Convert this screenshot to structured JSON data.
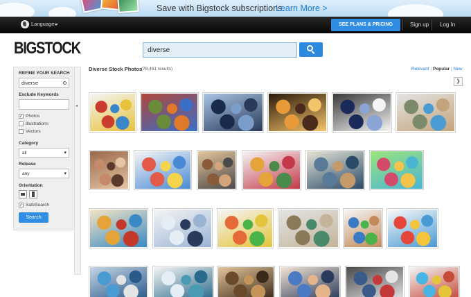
{
  "banner": {
    "text": "Save with Bigstock subscriptions.",
    "link": "Learn More >"
  },
  "topbar": {
    "language": "Language",
    "plans": "SEE PLANS & PRICING",
    "signup": "Sign up",
    "login": "Log In"
  },
  "header": {
    "logo": "BIGSTOCK",
    "search_value": "diverse"
  },
  "sidebar": {
    "refine_title": "REFINE YOUR SEARCH",
    "refine_value": "diverse",
    "exclude_title": "Exclude Keywords",
    "exclude_value": "",
    "types": [
      {
        "label": "Photos",
        "checked": true
      },
      {
        "label": "Illustrations",
        "checked": false
      },
      {
        "label": "Vectors",
        "checked": false
      }
    ],
    "category_title": "Category",
    "category_value": "all",
    "release_title": "Release",
    "release_value": "any",
    "orientation_title": "Orientation",
    "safesearch_label": "SafeSearch",
    "search_button": "Search"
  },
  "results": {
    "title": "Diverse Stock Photos",
    "count": "(78,461 results)",
    "sort_relevant": "Relevant",
    "sort_popular": "Popular",
    "sort_new": "New",
    "sep": "|"
  },
  "thumbnails": [
    {
      "subject": "crowd-group-photo",
      "colors": [
        "#c93c2e",
        "#3a86c9",
        "#e8c23a",
        "#f4f4f4"
      ]
    },
    {
      "subject": "social-media-icons",
      "colors": [
        "#6a8c3a",
        "#e07a2a",
        "#3a6ec9",
        "#b0463a"
      ]
    },
    {
      "subject": "silhouette-jumping",
      "colors": [
        "#1a2a4a",
        "#7a9ec9",
        "#2a3a5a",
        "#a8c4e4"
      ]
    },
    {
      "subject": "sunset-celebration",
      "colors": [
        "#e89a3a",
        "#4a2a1a",
        "#f4c46a",
        "#2a1a0a"
      ]
    },
    {
      "subject": "graduates",
      "colors": [
        "#1a2a5a",
        "#8aa4d4",
        "#f4f4f4",
        "#3a3a3a"
      ]
    },
    {
      "subject": "team-hands-desk",
      "colors": [
        "#7a8a6a",
        "#4a9ad4",
        "#c4a47a",
        "#e4e4e4"
      ]
    },
    {
      "subject": "face-collage",
      "colors": [
        "#c48a6a",
        "#5a3a2a",
        "#e4c4a4",
        "#9a6a4a"
      ]
    },
    {
      "subject": "kids-group",
      "colors": [
        "#e45a4a",
        "#f4d44a",
        "#4a8ad4",
        "#f4f4f4"
      ]
    },
    {
      "subject": "face-grid",
      "colors": [
        "#8a5a3a",
        "#d4a47a",
        "#4a4a4a",
        "#e4c49a"
      ]
    },
    {
      "subject": "children-sitting",
      "colors": [
        "#e4a43a",
        "#4a8a4a",
        "#c43a4a",
        "#f4f4f4"
      ]
    },
    {
      "subject": "business-table",
      "colors": [
        "#5a7a9a",
        "#c49a6a",
        "#2a4a6a",
        "#e4e4d4"
      ]
    },
    {
      "subject": "children-crowd",
      "colors": [
        "#d44a6a",
        "#f4c44a",
        "#4ab4d4",
        "#9ae47a"
      ]
    },
    {
      "subject": "happy-group",
      "colors": [
        "#e4a43a",
        "#c43a2a",
        "#3a8ac4",
        "#f4e4c4"
      ]
    },
    {
      "subject": "business-handshake",
      "colors": [
        "#e4eef4",
        "#2a3a5a",
        "#9ab4d4",
        "#f4f4f4"
      ]
    },
    {
      "subject": "kids-portrait",
      "colors": [
        "#e46a3a",
        "#4ab44a",
        "#e4c43a",
        "#f4f4f4"
      ]
    },
    {
      "subject": "office-desk-top",
      "colors": [
        "#8a7a5a",
        "#4a8a6a",
        "#c4b49a",
        "#e4e4e4"
      ]
    },
    {
      "subject": "hands-globe",
      "colors": [
        "#3a7ac4",
        "#4ab44a",
        "#c48a5a",
        "#f4f4f4"
      ]
    },
    {
      "subject": "give-letters",
      "colors": [
        "#e4473a",
        "#f4c43a",
        "#4a9ad4",
        "#f8f8f8"
      ]
    },
    {
      "subject": "speech-bubbles",
      "colors": [
        "#4a9ad4",
        "#e4e4e4",
        "#2a5a8a",
        "#c4d4e4"
      ]
    },
    {
      "subject": "medical-staff",
      "colors": [
        "#e4eef4",
        "#4a9ab4",
        "#2a6a8a",
        "#f4f4f4"
      ]
    },
    {
      "subject": "library-students",
      "colors": [
        "#6a4a2a",
        "#c4945a",
        "#3a2a1a",
        "#e4c49a"
      ]
    },
    {
      "subject": "students-smiling",
      "colors": [
        "#4a7ac4",
        "#e4b48a",
        "#2a3a5a",
        "#f4e4d4"
      ]
    },
    {
      "subject": "people-silhouettes",
      "colors": [
        "#3a5a8a",
        "#c43a3a",
        "#e4e4e4",
        "#4a4a4a"
      ]
    },
    {
      "subject": "friends-circle",
      "colors": [
        "#4ab4e4",
        "#e4c43a",
        "#c44a3a",
        "#f4f4f4"
      ]
    }
  ]
}
